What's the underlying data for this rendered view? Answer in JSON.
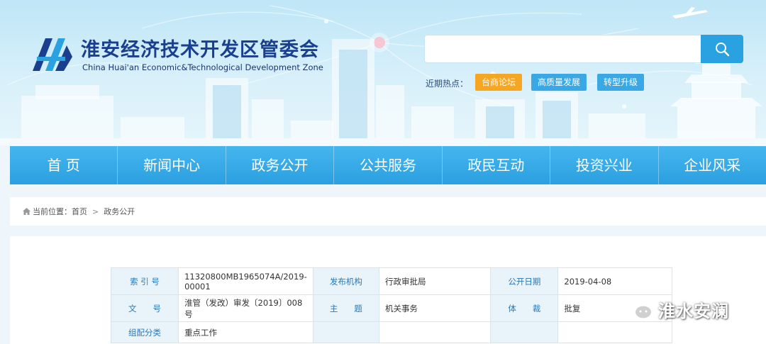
{
  "header": {
    "title_cn": "淮安经济技术开发区管委会",
    "title_en": "China Huai'an Economic&Technological Development Zone",
    "search": {
      "value": "",
      "placeholder": ""
    },
    "hot_label": "近期热点：",
    "hot_tags": [
      {
        "label": "台商论坛",
        "color": "#f5a623"
      },
      {
        "label": "高质量发展",
        "color": "#3aa8e4"
      },
      {
        "label": "转型升级",
        "color": "#3aa8e4"
      }
    ]
  },
  "nav": {
    "items": [
      "首 页",
      "新闻中心",
      "政务公开",
      "公共服务",
      "政民互动",
      "投资兴业",
      "企业风采"
    ]
  },
  "breadcrumb": {
    "prefix": "当前位置：",
    "items": [
      "首页",
      "政务公开"
    ],
    "separator": ">"
  },
  "meta_table": {
    "rows": [
      [
        {
          "label": "索 引 号",
          "value": "11320800MB1965074A/2019-00001"
        },
        {
          "label": "发布机构",
          "value": "行政审批局"
        },
        {
          "label": "公开日期",
          "value": "2019-04-08"
        }
      ],
      [
        {
          "label": "文　　号",
          "value": "淮管（发改）审发〔2019〕008号"
        },
        {
          "label": "主　　题",
          "value": "机关事务"
        },
        {
          "label": "体　　裁",
          "value": "批复"
        }
      ],
      [
        {
          "label": "组配分类",
          "value": "重点工作"
        },
        {
          "label": "",
          "value": ""
        },
        {
          "label": "",
          "value": ""
        }
      ]
    ]
  },
  "watermark": {
    "text": "淮水安澜"
  },
  "colors": {
    "nav_bg": "#2b9fe0",
    "title": "#1a3f8e",
    "label_bg": "#e9f3fa",
    "label_text": "#2d78b4",
    "accent_orange": "#f5a623"
  }
}
